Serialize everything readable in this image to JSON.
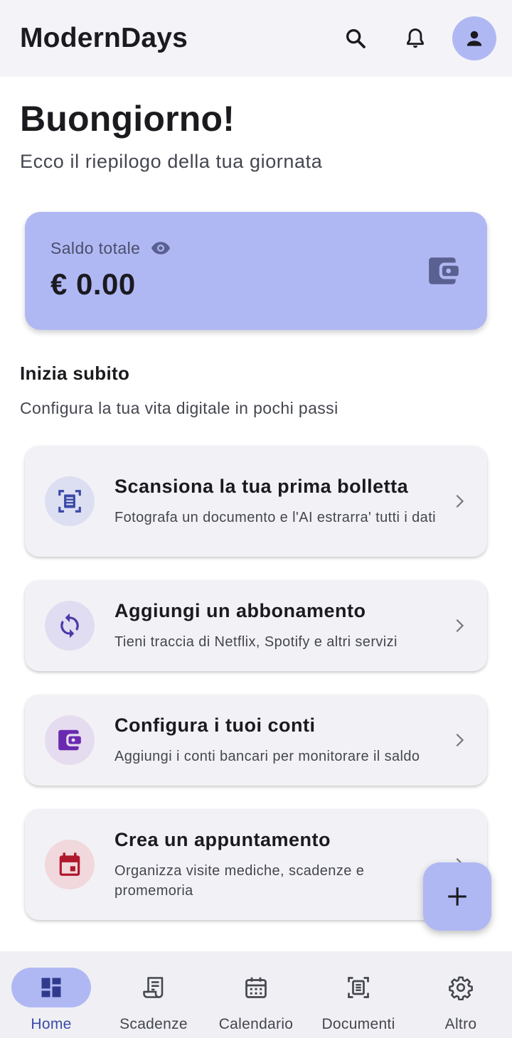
{
  "app": {
    "title": "ModernDays"
  },
  "appbar": {
    "icons": [
      "search-icon",
      "bell-icon",
      "account-icon"
    ]
  },
  "greeting": {
    "title": "Buongiorno!",
    "subtitle": "Ecco il riepilogo della tua giornata"
  },
  "balance": {
    "label": "Saldo totale",
    "value": "€ 0.00",
    "icons": [
      "eye-icon",
      "wallet-icon"
    ]
  },
  "start": {
    "title": "Inizia subito",
    "subtitle": "Configura la tua vita digitale in pochi passi"
  },
  "actions": [
    {
      "title": "Scansiona la tua prima bolletta",
      "subtitle": "Fotografa un documento e l'AI estrarra' tutti i dati",
      "icon": "document-scanner-icon",
      "icon_color": "#3a4aa8",
      "icon_bg": "#dcdff2"
    },
    {
      "title": "Aggiungi un abbonamento",
      "subtitle": "Tieni traccia di Netflix, Spotify e altri servizi",
      "icon": "sync-icon",
      "icon_color": "#4a3aa8",
      "icon_bg": "#e0ddf2"
    },
    {
      "title": "Configura i tuoi conti",
      "subtitle": "Aggiungi i conti bancari per monitorare il saldo",
      "icon": "wallet-icon",
      "icon_color": "#6a2ab0",
      "icon_bg": "#e6dcf0"
    },
    {
      "title": "Crea un appuntamento",
      "subtitle": "Organizza visite mediche, scadenze e promemoria",
      "icon": "calendar-event-icon",
      "icon_color": "#b0182c",
      "icon_bg": "#f0d8dc"
    }
  ],
  "fab": {
    "icon": "plus-icon"
  },
  "nav": {
    "items": [
      {
        "label": "Home",
        "icon": "dashboard-icon",
        "active": true
      },
      {
        "label": "Scadenze",
        "icon": "receipt-icon",
        "active": false
      },
      {
        "label": "Calendario",
        "icon": "calendar-icon",
        "active": false
      },
      {
        "label": "Documenti",
        "icon": "document-scanner-icon",
        "active": false
      },
      {
        "label": "Altro",
        "icon": "gear-icon",
        "active": false
      }
    ]
  },
  "colors": {
    "accent": "#b0b8f4",
    "active_label": "#3a4aa8",
    "background": "#ffffff",
    "appbar": "#f4f4f8"
  }
}
